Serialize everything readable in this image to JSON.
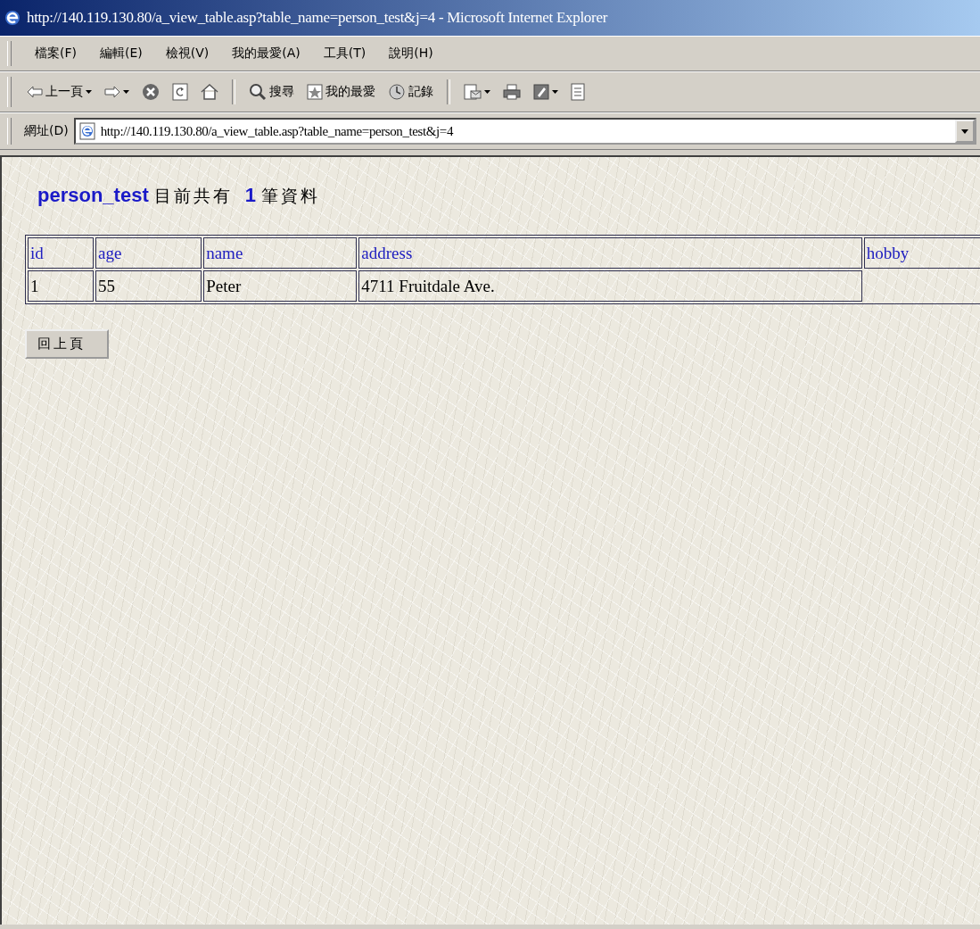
{
  "window": {
    "title": "http://140.119.130.80/a_view_table.asp?table_name=person_test&j=4 - Microsoft Internet Explorer"
  },
  "menu_bar": [
    "檔案(F)",
    "編輯(E)",
    "檢視(V)",
    "我的最愛(A)",
    "工具(T)",
    "說明(H)"
  ],
  "toolbar": [
    {
      "kind": "back",
      "label": "上一頁",
      "dropdown": true
    },
    {
      "kind": "forward",
      "dropdown": true
    },
    {
      "kind": "stop",
      "dropdown": false
    },
    {
      "kind": "refresh",
      "dropdown": false
    },
    {
      "kind": "home",
      "dropdown": false
    },
    {
      "kind": "separator"
    },
    {
      "kind": "search",
      "label": "搜尋",
      "dropdown": false
    },
    {
      "kind": "favorites",
      "label": "我的最愛",
      "dropdown": false
    },
    {
      "kind": "history",
      "label": "記錄",
      "dropdown": false
    },
    {
      "kind": "separator"
    },
    {
      "kind": "mail",
      "dropdown": true
    },
    {
      "kind": "print",
      "dropdown": false
    },
    {
      "kind": "edit",
      "dropdown": true
    },
    {
      "kind": "discuss",
      "dropdown": false
    }
  ],
  "address_bar": {
    "label": "網址(D)",
    "value": "http://140.119.130.80/a_view_table.asp?table_name=person_test&j=4"
  },
  "page": {
    "heading": {
      "table_name": "person_test",
      "text_before": "目前共有",
      "count": "1",
      "text_after": "筆資料"
    },
    "table": {
      "columns": [
        "id",
        "age",
        "name",
        "address",
        "hobby"
      ],
      "rows": [
        {
          "cells": [
            "1",
            "55",
            "Peter",
            "4711 Fruitdale Ave."
          ]
        }
      ]
    },
    "back_button": "回上頁"
  }
}
